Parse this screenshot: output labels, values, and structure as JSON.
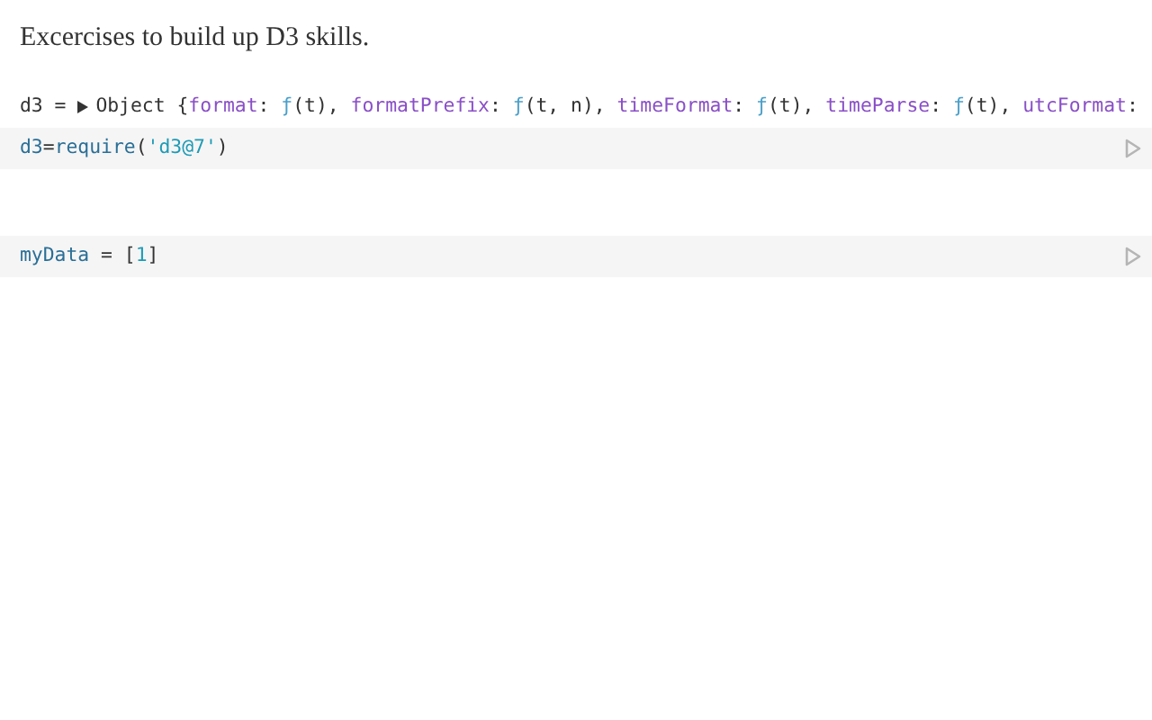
{
  "intro": "Excercises to build up D3 skills.",
  "cells": [
    {
      "output": {
        "variable": "d3 = ",
        "expanded": false,
        "tokens": [
          {
            "kind": "plain",
            "text": "Object {"
          },
          {
            "kind": "key",
            "text": "format"
          },
          {
            "kind": "plain",
            "text": ": "
          },
          {
            "kind": "fn",
            "text": "ƒ"
          },
          {
            "kind": "plain",
            "text": "(t), "
          },
          {
            "kind": "key",
            "text": "formatPrefix"
          },
          {
            "kind": "plain",
            "text": ": "
          },
          {
            "kind": "fn",
            "text": "ƒ"
          },
          {
            "kind": "plain",
            "text": "(t, n), "
          },
          {
            "kind": "key",
            "text": "timeFormat"
          },
          {
            "kind": "plain",
            "text": ": "
          },
          {
            "kind": "fn",
            "text": "ƒ"
          },
          {
            "kind": "plain",
            "text": "(t), "
          },
          {
            "kind": "key",
            "text": "timeParse"
          },
          {
            "kind": "plain",
            "text": ": "
          },
          {
            "kind": "fn",
            "text": "ƒ"
          },
          {
            "kind": "plain",
            "text": "(t), "
          },
          {
            "kind": "key",
            "text": "utcFormat"
          },
          {
            "kind": "plain",
            "text": ":"
          }
        ]
      },
      "code": [
        {
          "kind": "var",
          "text": "d3"
        },
        {
          "kind": "plain",
          "text": "="
        },
        {
          "kind": "var",
          "text": "require"
        },
        {
          "kind": "plain",
          "text": "("
        },
        {
          "kind": "string",
          "text": "'d3@7'"
        },
        {
          "kind": "plain",
          "text": ")"
        }
      ]
    },
    {
      "code": [
        {
          "kind": "var",
          "text": "myData"
        },
        {
          "kind": "plain",
          "text": " = ["
        },
        {
          "kind": "number",
          "text": "1"
        },
        {
          "kind": "plain",
          "text": "]"
        }
      ]
    }
  ]
}
